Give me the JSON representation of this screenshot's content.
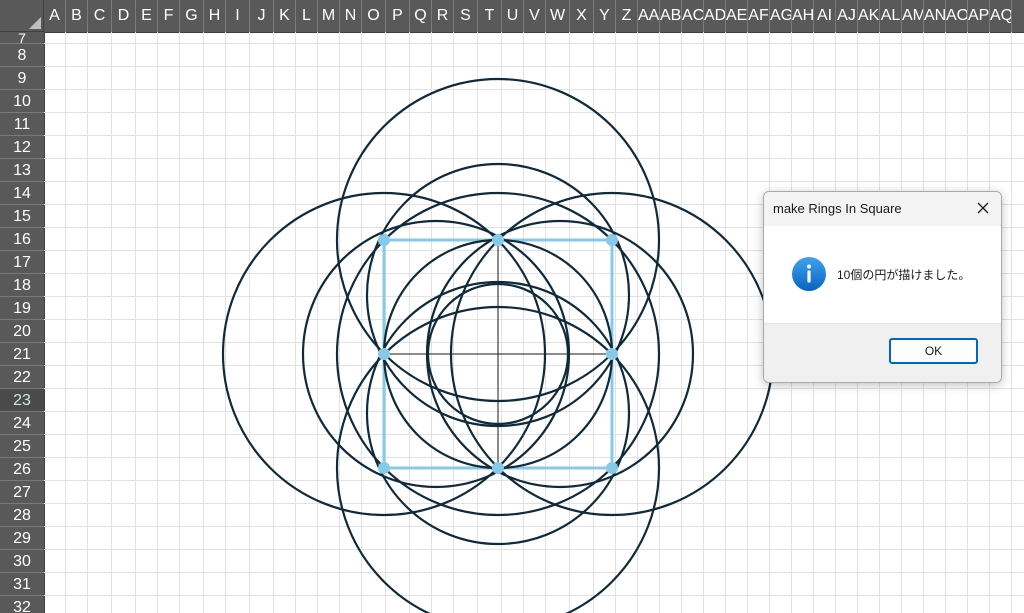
{
  "spreadsheet": {
    "columns": [
      "A",
      "B",
      "C",
      "D",
      "E",
      "F",
      "G",
      "H",
      "I",
      "J",
      "K",
      "L",
      "M",
      "N",
      "O",
      "P",
      "Q",
      "R",
      "S",
      "T",
      "U",
      "V",
      "W",
      "X",
      "Y",
      "Z",
      "AA",
      "AB",
      "AC",
      "AD",
      "AE",
      "AF",
      "AG",
      "AH",
      "AI",
      "AJ",
      "AK",
      "AL",
      "AM",
      "AN",
      "AO",
      "AP",
      "AQ"
    ],
    "rows": [
      "7",
      "8",
      "9",
      "10",
      "11",
      "12",
      "13",
      "14",
      "15",
      "16",
      "17",
      "18",
      "19",
      "20",
      "21",
      "22",
      "23",
      "24",
      "25",
      "26",
      "27",
      "28",
      "29",
      "30",
      "31",
      "32"
    ],
    "active_row": "23"
  },
  "drawing": {
    "shape": "rings-in-square",
    "ring_count": 10,
    "ring_color": "#0f2a3a",
    "square_color": "#87c9e8",
    "axis_color": "#1a1a1a"
  },
  "dialog": {
    "title": "make Rings In Square",
    "message": "10個の円が描けました。",
    "ok_label": "OK",
    "icon": "info-icon",
    "accent": "#0067c0"
  }
}
